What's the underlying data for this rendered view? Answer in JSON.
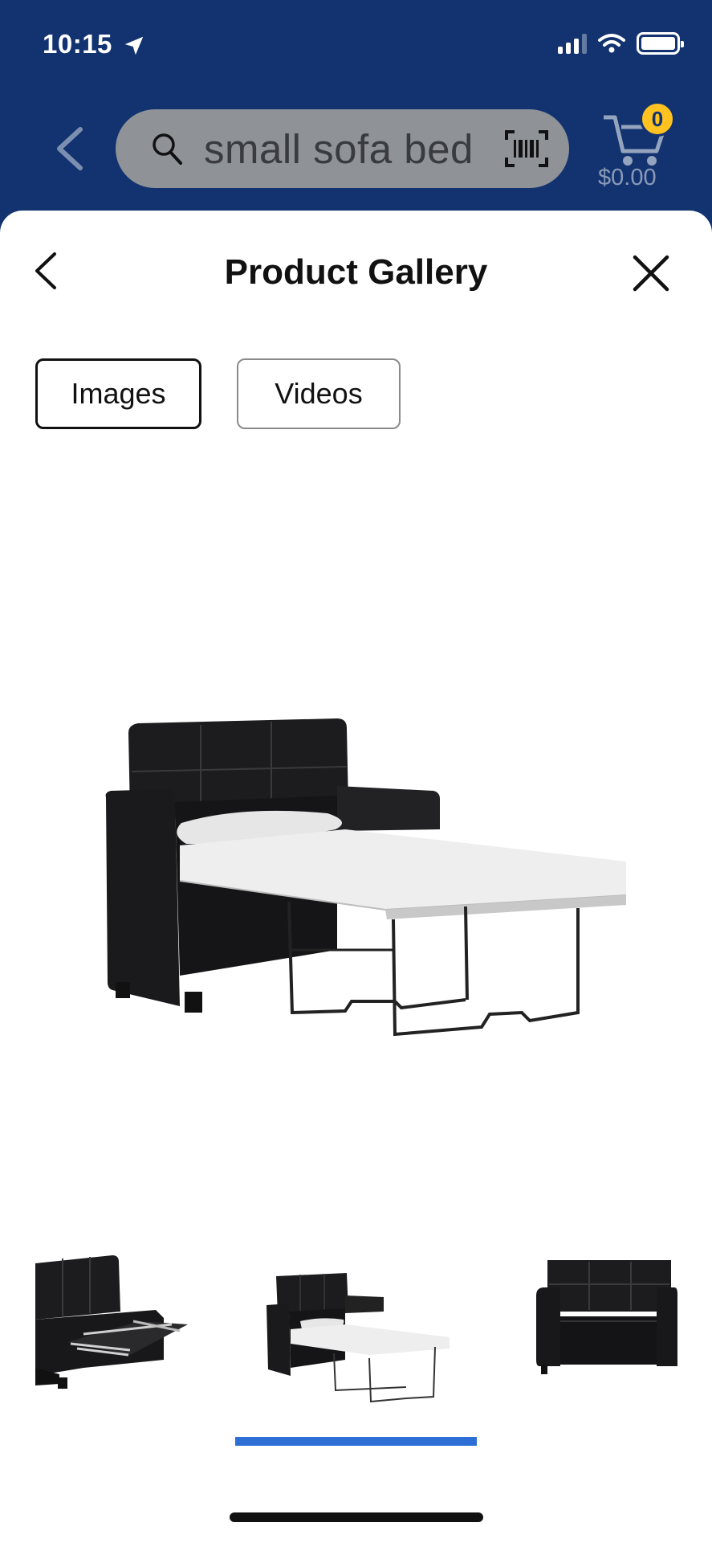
{
  "status_bar": {
    "time": "10:15"
  },
  "header": {
    "search_query": "small sofa bed",
    "cart_count": "0",
    "cart_total": "$0.00"
  },
  "sheet": {
    "title": "Product Gallery",
    "tabs": [
      {
        "label": "Images",
        "selected": true
      },
      {
        "label": "Videos",
        "selected": false
      }
    ]
  },
  "gallery": {
    "selected_index": 1,
    "thumbnail_count": 3
  },
  "colors": {
    "header_bg": "#12336f",
    "accent_blue": "#2e6fd6",
    "badge_yellow": "#ffc220"
  }
}
